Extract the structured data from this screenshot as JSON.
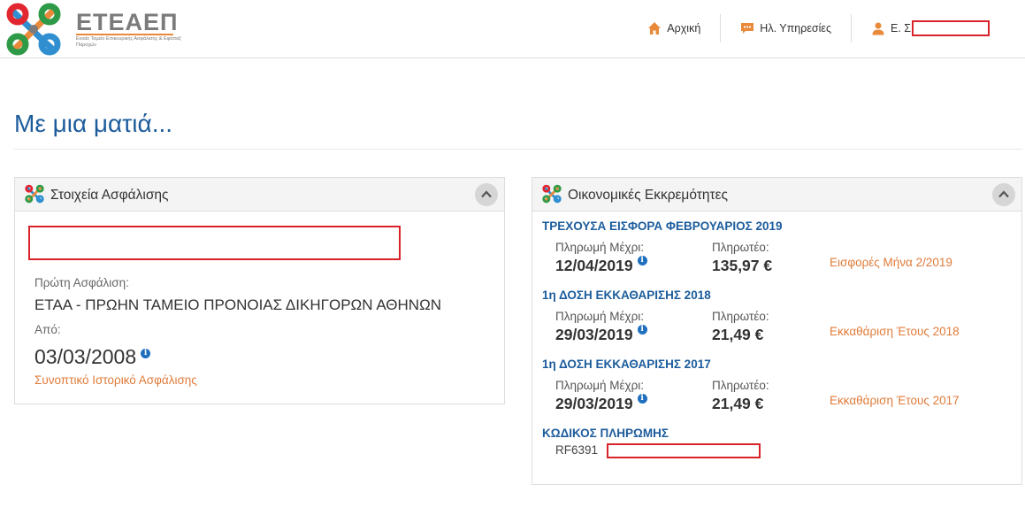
{
  "header": {
    "brand": "ΕΤΕΑΕΠ",
    "tagline": "Ενιαίο Ταμείο Επικουρικής Ασφάλισης & Εφάπαξ Παροχών",
    "nav": {
      "home": "Αρχική",
      "eservices": "Ηλ. Υπηρεσίες",
      "user_prefix": "Ε. Σ"
    }
  },
  "page": {
    "title": "Με μια ματιά..."
  },
  "insurance_panel": {
    "title": "Στοιχεία Ασφάλισης",
    "first_insurance_label": "Πρώτη Ασφάλιση:",
    "first_insurance_value": "ΕΤΑΑ - ΠΡΩΗΝ ΤΑΜΕΙΟ ΠΡΟΝΟΙΑΣ ΔΙΚΗΓΟΡΩΝ ΑΘΗΝΩΝ",
    "from_label": "Από:",
    "from_value": "03/03/2008",
    "history_link": "Συνοπτικό Ιστορικό Ασφάλισης"
  },
  "financial_panel": {
    "title": "Οικονομικές Εκκρεμότητες",
    "items": [
      {
        "heading": "ΤΡΕΧΟΥΣΑ ΕΙΣΦΟΡΑ ΦΕΒΡΟΥΑΡΙΟΣ 2019",
        "due_label": "Πληρωμή Μέχρι:",
        "due_date": "12/04/2019",
        "amount_label": "Πληρωτέο:",
        "amount": "135,97 €",
        "link": "Εισφορές Μήνα 2/2019"
      },
      {
        "heading": "1η ΔΟΣΗ ΕΚΚΑΘΑΡΙΣΗΣ 2018",
        "due_label": "Πληρωμή Μέχρι:",
        "due_date": "29/03/2019",
        "amount_label": "Πληρωτέο:",
        "amount": "21,49 €",
        "link": "Εκκαθάριση Έτους 2018"
      },
      {
        "heading": "1η ΔΟΣΗ ΕΚΚΑΘΑΡΙΣΗΣ 2017",
        "due_label": "Πληρωμή Μέχρι:",
        "due_date": "29/03/2019",
        "amount_label": "Πληρωτέο:",
        "amount": "21,49 €",
        "link": "Εκκαθάριση Έτους 2017"
      }
    ],
    "payment_code_title": "ΚΩΔΙΚΟΣ ΠΛΗΡΩΜΗΣ",
    "payment_code_prefix": "RF6391"
  },
  "colors": {
    "primary_blue": "#1c5c9c",
    "link_orange": "#e07b39",
    "redaction_red": "#d8232a"
  }
}
